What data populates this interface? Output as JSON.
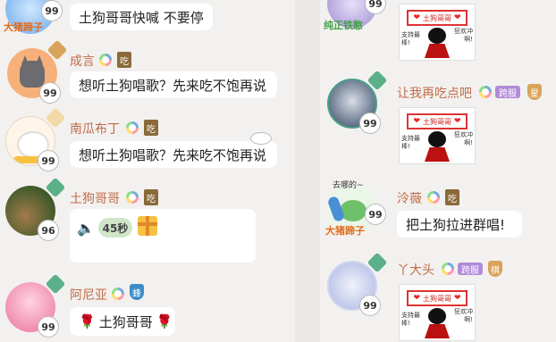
{
  "left": {
    "messages": [
      {
        "name": "",
        "level": "99",
        "text": "土狗哥哥快喊 不要停",
        "avatar_caption": "大猪蹄子"
      },
      {
        "name": "成言",
        "level": "99",
        "text": "想听土狗唱歌？先来吃不饱再说",
        "badge": "吃"
      },
      {
        "name": "南瓜布丁",
        "level": "99",
        "text": "想听土狗唱歌？先来吃不饱再说",
        "badge": "吃"
      },
      {
        "name": "土狗哥哥",
        "level": "96",
        "voice_duration": "45秒",
        "badge": "吃"
      },
      {
        "name": "阿尼亚",
        "level": "99",
        "text": "土狗哥哥",
        "badge": "蜂",
        "flower": "🌹"
      }
    ]
  },
  "right": {
    "messages": [
      {
        "name": "",
        "level": "99",
        "avatar_caption": "纯正铁憨",
        "sticker": {
          "top": "土狗哥哥",
          "left": "支持最棒!",
          "right": "狂欢冲啊!"
        }
      },
      {
        "name": "让我再吃点吧",
        "level": "99",
        "tag": "跨服",
        "rank": "星",
        "sticker": {
          "top": "土狗哥哥",
          "left": "支持最棒!",
          "right": "狂欢冲啊!"
        }
      },
      {
        "name": "泠薇",
        "level": "99",
        "badge": "吃",
        "text": "把土狗拉进群唱!",
        "avatar_caption": "大猪蹄子",
        "avatar_bubble": "去哪的~"
      },
      {
        "name": "丫大头",
        "level": "99",
        "tag": "跨服",
        "rank": "棋",
        "sticker": {
          "top": "土狗哥哥",
          "left": "支持最棒!",
          "right": "狂欢冲啊!"
        }
      }
    ]
  },
  "colors": {
    "name": "#c06c4a",
    "bubble": "#ffffff",
    "background": "#f3f1ef",
    "tag": "#b08ad8"
  }
}
